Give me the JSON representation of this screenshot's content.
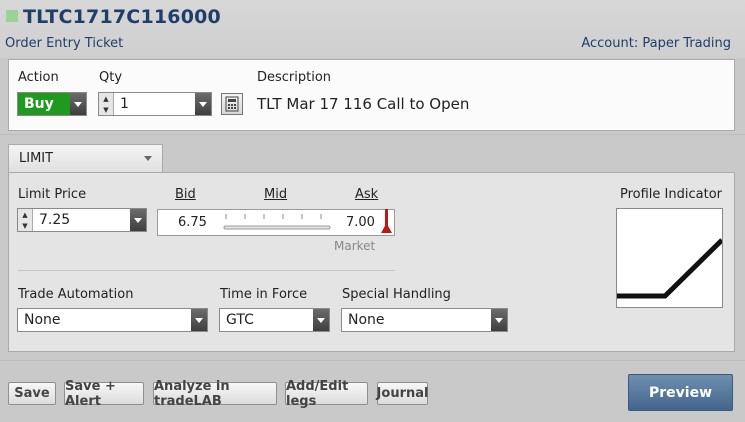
{
  "header": {
    "symbol": "TLTC1717C116000",
    "ticket_title": "Order Entry Ticket",
    "account": "Account: Paper Trading"
  },
  "order": {
    "action_label": "Action",
    "action_value": "Buy",
    "qty_label": "Qty",
    "qty_value": "1",
    "description_label": "Description",
    "description_value": "TLT Mar 17 116 Call  to Open"
  },
  "order_type_tab": "LIMIT",
  "limit": {
    "price_label": "Limit Price",
    "price_value": "7.25",
    "bid_label": "Bid",
    "mid_label": "Mid",
    "ask_label": "Ask",
    "bid_value": "6.75",
    "ask_value": "7.00",
    "market_label": "Market"
  },
  "profile_indicator_label": "Profile Indicator",
  "trade_automation": {
    "label": "Trade Automation",
    "value": "None"
  },
  "time_in_force": {
    "label": "Time in Force",
    "value": "GTC"
  },
  "special_handling": {
    "label": "Special Handling",
    "value": "None"
  },
  "buttons": {
    "save": "Save",
    "save_alert": "Save + Alert",
    "analyze": "Analyze in tradeLAB",
    "add_edit_legs": "Add/Edit legs",
    "journal": "Journal",
    "preview": "Preview"
  },
  "colors": {
    "buy_green": "#1f9a1f",
    "header_blue": "#1f3e6a",
    "preview_blue": "#4d6f95",
    "ask_marker_red": "#c01818"
  }
}
